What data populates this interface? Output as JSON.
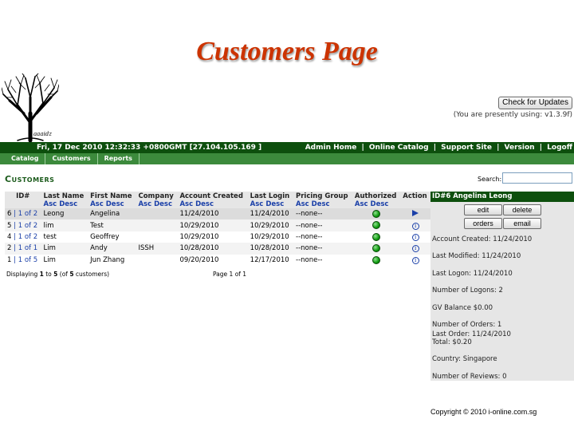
{
  "slide": {
    "title": "Customers Page",
    "copyright": "Copyright © 2010  i-online.com.sg"
  },
  "logo": {
    "caption": "aaaidz"
  },
  "header": {
    "check_updates_label": "Check for Updates",
    "version_note": "(You are presently using: v1.3.9f)",
    "datetime": "Fri, 17 Dec 2010 12:32:33 +0800GMT [27.104.105.169 ]",
    "links": [
      "Admin Home",
      "Online Catalog",
      "Support Site",
      "Version",
      "Logoff"
    ],
    "link_separator": "|"
  },
  "menu": [
    "Catalog",
    "Customers",
    "Reports"
  ],
  "page": {
    "heading": "Customers",
    "search_label": "Search:",
    "search_value": ""
  },
  "table": {
    "columns": [
      "ID#",
      "Last Name",
      "First Name",
      "Company",
      "Account Created",
      "Last Login",
      "Pricing Group",
      "Authorized",
      "Action"
    ],
    "sort_asc": "Asc",
    "sort_desc": "Desc",
    "rows": [
      {
        "id": "6",
        "sep": "|",
        "link": "1 of 2",
        "last": "Leong",
        "first": "Angelina",
        "company": "",
        "created": "11/24/2010",
        "login": "11/24/2010",
        "group": "--none--",
        "authorized": true,
        "action": "arrow-icon",
        "selected": true
      },
      {
        "id": "5",
        "sep": "|",
        "link": "1 of 2",
        "last": "lim",
        "first": "Test",
        "company": "",
        "created": "10/29/2010",
        "login": "10/29/2010",
        "group": "--none--",
        "authorized": true,
        "action": "info-icon"
      },
      {
        "id": "4",
        "sep": "|",
        "link": "1 of 2",
        "last": "test",
        "first": "Geoffrey",
        "company": "",
        "created": "10/29/2010",
        "login": "10/29/2010",
        "group": "--none--",
        "authorized": true,
        "action": "info-icon"
      },
      {
        "id": "2",
        "sep": "|",
        "link": "1 of 1",
        "last": "Lim",
        "first": "Andy",
        "company": "ISSH",
        "created": "10/28/2010",
        "login": "10/28/2010",
        "group": "--none--",
        "authorized": true,
        "action": "info-icon"
      },
      {
        "id": "1",
        "sep": "|",
        "link": "1 of 5",
        "last": "Lim",
        "first": "Jun Zhang",
        "company": "",
        "created": "09/20/2010",
        "login": "12/17/2010",
        "group": "--none--",
        "authorized": true,
        "action": "info-icon"
      }
    ],
    "displaying": [
      "Displaying ",
      "1",
      " to ",
      "5",
      " (of ",
      "5",
      " customers)"
    ],
    "pagination": "Page 1 of 1"
  },
  "panel": {
    "title": "ID#6 Angelina Leong",
    "buttons": [
      "edit",
      "delete",
      "orders",
      "email"
    ],
    "lines": [
      "Account Created: 11/24/2010",
      "Last Modified: 11/24/2010",
      "Last Logon: 11/24/2010",
      "Number of Logons: 2",
      "GV Balance $0.00",
      "Number of Orders: 1",
      "Last Order: 11/24/2010",
      "Total: $0.20",
      "Country: Singapore",
      "Number of Reviews: 0"
    ]
  },
  "colors": {
    "title": "#cc3300",
    "header_bar": "#0d4f0d",
    "menu_bar": "#3c8a3c",
    "link": "#1a3fa8",
    "authorized": "#0e9a0e"
  }
}
